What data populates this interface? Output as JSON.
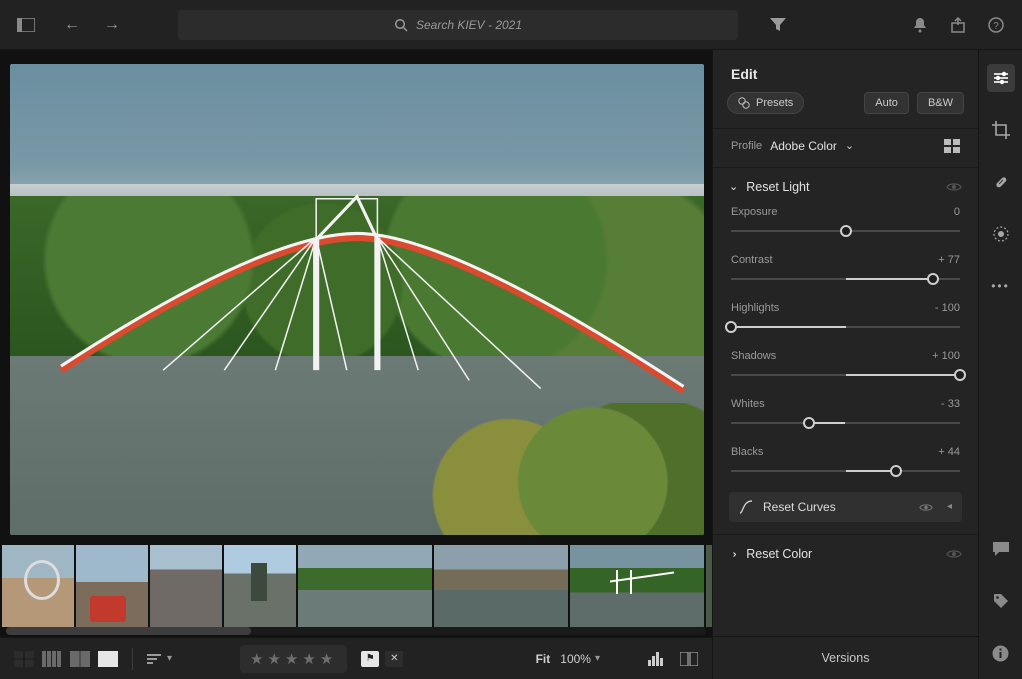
{
  "topbar": {
    "search_placeholder": "Search KIEV - 2021"
  },
  "edit": {
    "title": "Edit",
    "presets_label": "Presets",
    "auto_label": "Auto",
    "bw_label": "B&W",
    "profile_label": "Profile",
    "profile_value": "Adobe Color",
    "light_section": "Reset Light",
    "color_section": "Reset Color",
    "curves_label": "Reset Curves",
    "versions_label": "Versions",
    "sliders": {
      "exposure": {
        "label": "Exposure",
        "display": "0",
        "pct": 50
      },
      "contrast": {
        "label": "Contrast",
        "display": "+ 77",
        "pct": 88
      },
      "highlights": {
        "label": "Highlights",
        "display": "- 100",
        "pct": 0
      },
      "shadows": {
        "label": "Shadows",
        "display": "+ 100",
        "pct": 100
      },
      "whites": {
        "label": "Whites",
        "display": "- 33",
        "pct": 34
      },
      "blacks": {
        "label": "Blacks",
        "display": "+ 44",
        "pct": 72
      }
    }
  },
  "bottombar": {
    "fit_label": "Fit",
    "zoom_label": "100%"
  },
  "filmstrip": {
    "count": 7,
    "selected_index": 6
  }
}
